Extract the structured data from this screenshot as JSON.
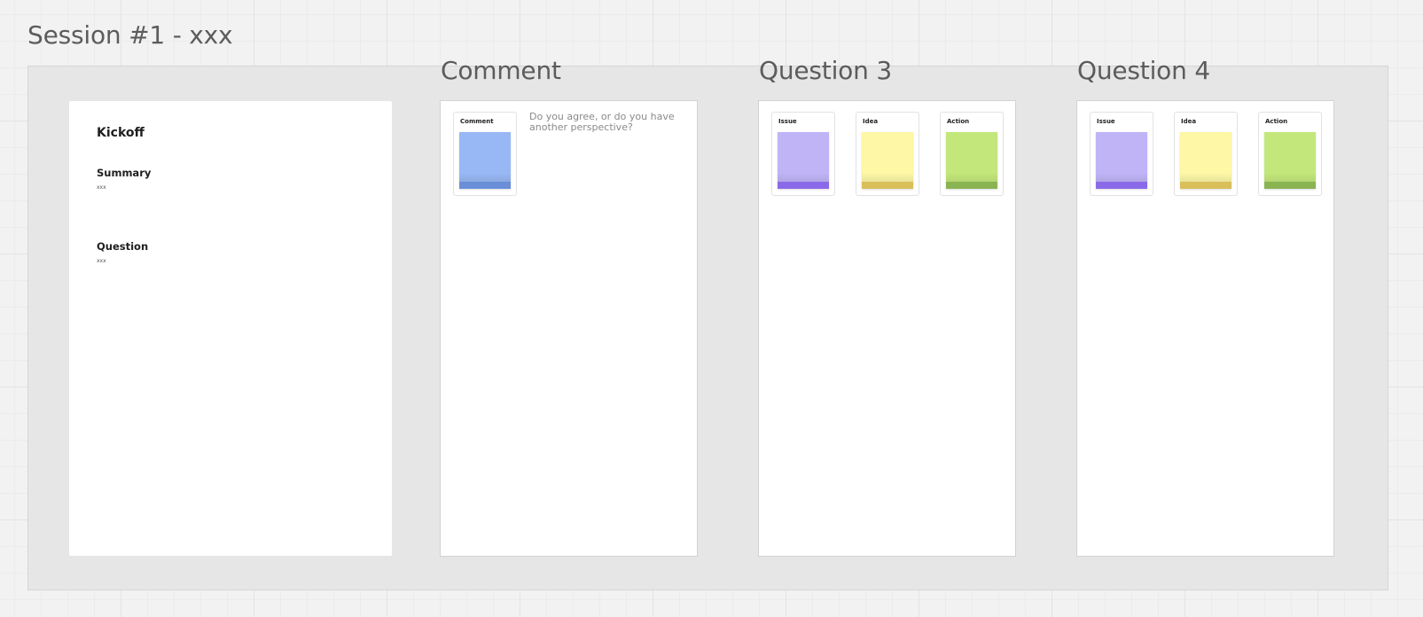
{
  "session": {
    "title": "Session #1 - xxx"
  },
  "kickoff": {
    "title": "Kickoff",
    "summary_label": "Summary",
    "summary_value": "xxx",
    "question_label": "Question",
    "question_value": "xxx"
  },
  "columns": [
    {
      "title": "Comment",
      "hint": "Do you agree, or do you have another perspective?",
      "notes": [
        {
          "label": "Comment",
          "color": "#98b8f5",
          "strip": "#6a8fd8"
        }
      ]
    },
    {
      "title": "Question 3",
      "notes": [
        {
          "label": "Issue",
          "color": "#c0b4f7",
          "strip": "#8a6ae8"
        },
        {
          "label": "Idea",
          "color": "#fdf7a6",
          "strip": "#d9bf5a"
        },
        {
          "label": "Action",
          "color": "#c3e77a",
          "strip": "#8ab352"
        }
      ]
    },
    {
      "title": "Question 4",
      "notes": [
        {
          "label": "Issue",
          "color": "#c0b4f7",
          "strip": "#8a6ae8"
        },
        {
          "label": "Idea",
          "color": "#fdf7a6",
          "strip": "#d9bf5a"
        },
        {
          "label": "Action",
          "color": "#c3e77a",
          "strip": "#8ab352"
        }
      ]
    }
  ]
}
